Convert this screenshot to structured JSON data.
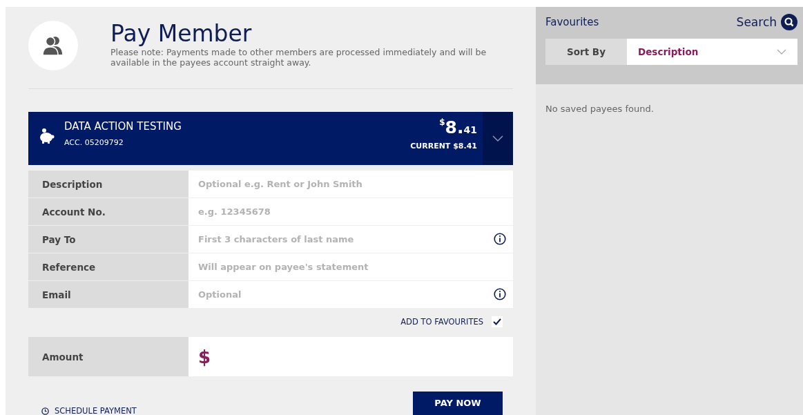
{
  "header": {
    "title": "Pay Member",
    "note": "Please note: Payments made to other members are processed immediately and will be available in the payees account straight away."
  },
  "account": {
    "name": "DATA ACTION TESTING",
    "number": "ACC. 05209792",
    "currency": "$",
    "balance_whole": "8.",
    "balance_cents": "41",
    "current": "CURRENT $8.41"
  },
  "fields": [
    {
      "label": "Description",
      "placeholder": "Optional e.g. Rent or John Smith",
      "info": false
    },
    {
      "label": "Account No.",
      "placeholder": "e.g. 12345678",
      "info": false
    },
    {
      "label": "Pay To",
      "placeholder": "First 3 characters of last name",
      "info": true
    },
    {
      "label": "Reference",
      "placeholder": "Will appear on payee's statement",
      "info": false
    },
    {
      "label": "Email",
      "placeholder": "Optional",
      "info": true
    }
  ],
  "add_to_favourites": {
    "label": "ADD TO FAVOURITES",
    "checked": true
  },
  "amount": {
    "label": "Amount",
    "currency": "$"
  },
  "schedule_link": "SCHEDULE PAYMENT",
  "pay_button": "PAY NOW",
  "favourites": {
    "title": "Favourites",
    "search": "Search",
    "sort_label": "Sort By",
    "sort_value": "Description",
    "empty": "No saved payees found."
  }
}
